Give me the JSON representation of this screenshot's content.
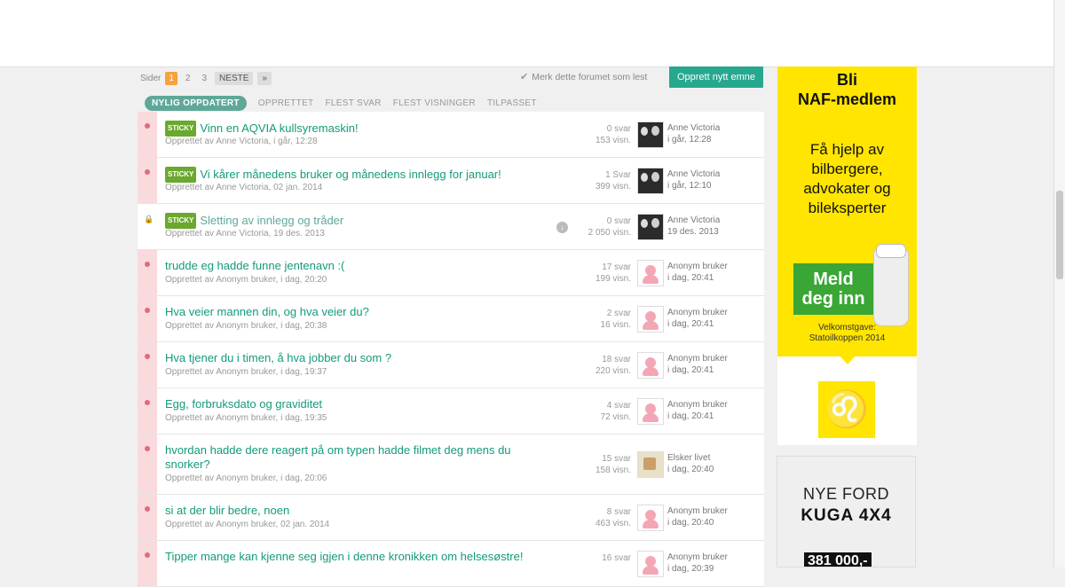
{
  "pager": {
    "label": "Sider",
    "pages": [
      "1",
      "2",
      "3"
    ],
    "next": "NESTE",
    "more": "»"
  },
  "mark_read": "Merk dette forumet som lest",
  "new_topic": "Opprett nytt emne",
  "tabs": [
    "NYLIG OPPDATERT",
    "OPPRETTET",
    "FLEST SVAR",
    "FLEST VISNINGER",
    "TILPASSET"
  ],
  "sticky_badge": "STICKY",
  "rows": [
    {
      "title": "Vinn en AQVIA kullsyremaskin!",
      "meta": "Opprettet av Anne Victoria, i går, 12:28",
      "replies": "0 svar",
      "views": "153 visn.",
      "last_user": "Anne Victoria",
      "last_time": "i går, 12:28"
    },
    {
      "title": "Vi kårer månedens bruker og månedens innlegg for januar!",
      "meta": "Opprettet av Anne Victoria, 02 jan. 2014",
      "replies": "1 Svar",
      "views": "399 visn.",
      "last_user": "Anne Victoria",
      "last_time": "i går, 12:10"
    },
    {
      "title": "Sletting av innlegg og tråder",
      "meta": "Opprettet av Anne Victoria, 19 des. 2013",
      "replies": "0 svar",
      "views": "2 050 visn.",
      "last_user": "Anne Victoria",
      "last_time": "19 des. 2013"
    },
    {
      "title": "trudde eg hadde funne jentenavn :(",
      "meta": "Opprettet av Anonym bruker, i dag, 20:20",
      "replies": "17 svar",
      "views": "199 visn.",
      "last_user": "Anonym bruker",
      "last_time": "i dag, 20:41"
    },
    {
      "title": "Hva veier mannen din, og hva veier du?",
      "meta": "Opprettet av Anonym bruker, i dag, 20:38",
      "replies": "2 svar",
      "views": "16 visn.",
      "last_user": "Anonym bruker",
      "last_time": "i dag, 20:41"
    },
    {
      "title": "Hva tjener du i timen, å hva jobber du som ?",
      "meta": "Opprettet av Anonym bruker, i dag, 19:37",
      "replies": "18 svar",
      "views": "220 visn.",
      "last_user": "Anonym bruker",
      "last_time": "i dag, 20:41"
    },
    {
      "title": "Egg, forbruksdato og graviditet",
      "meta": "Opprettet av Anonym bruker, i dag, 19:35",
      "replies": "4 svar",
      "views": "72 visn.",
      "last_user": "Anonym bruker",
      "last_time": "i dag, 20:41"
    },
    {
      "title": "hvordan hadde dere reagert på om typen hadde filmet deg mens du snorker?",
      "meta": "Opprettet av Anonym bruker, i dag, 20:06",
      "replies": "15 svar",
      "views": "158 visn.",
      "last_user": "Elsker livet",
      "last_time": "i dag, 20:40"
    },
    {
      "title": "si at der blir bedre, noen",
      "meta": "Opprettet av Anonym bruker, 02 jan. 2014",
      "replies": "8 svar",
      "views": "463 visn.",
      "last_user": "Anonym bruker",
      "last_time": "i dag, 20:40"
    },
    {
      "title": "Tipper mange kan kjenne seg igjen i denne kronikken om helsesøstre!",
      "meta": "",
      "replies": "16 svar",
      "views": "",
      "last_user": "Anonym bruker",
      "last_time": "i dag, 20:39"
    }
  ],
  "ad_naf": {
    "head1": "Bli",
    "head2": "NAF-medlem",
    "body1": "Få hjelp av",
    "body2": "bilbergere,",
    "body3": "advokater og",
    "body4": "bileksperter",
    "cta1": "Meld",
    "cta2": "deg inn",
    "gift1": "Velkomstgave:",
    "gift2": "Statoilkoppen 2014"
  },
  "ad_ford": {
    "line1": "NYE FORD",
    "line2": "KUGA 4X4",
    "price": "381 000,-"
  },
  "colors": {
    "accent": "#26a88f",
    "link": "#139b7a",
    "sticky": "#6aa82e",
    "unread": "#e06a80",
    "naf_yellow": "#ffe500"
  }
}
